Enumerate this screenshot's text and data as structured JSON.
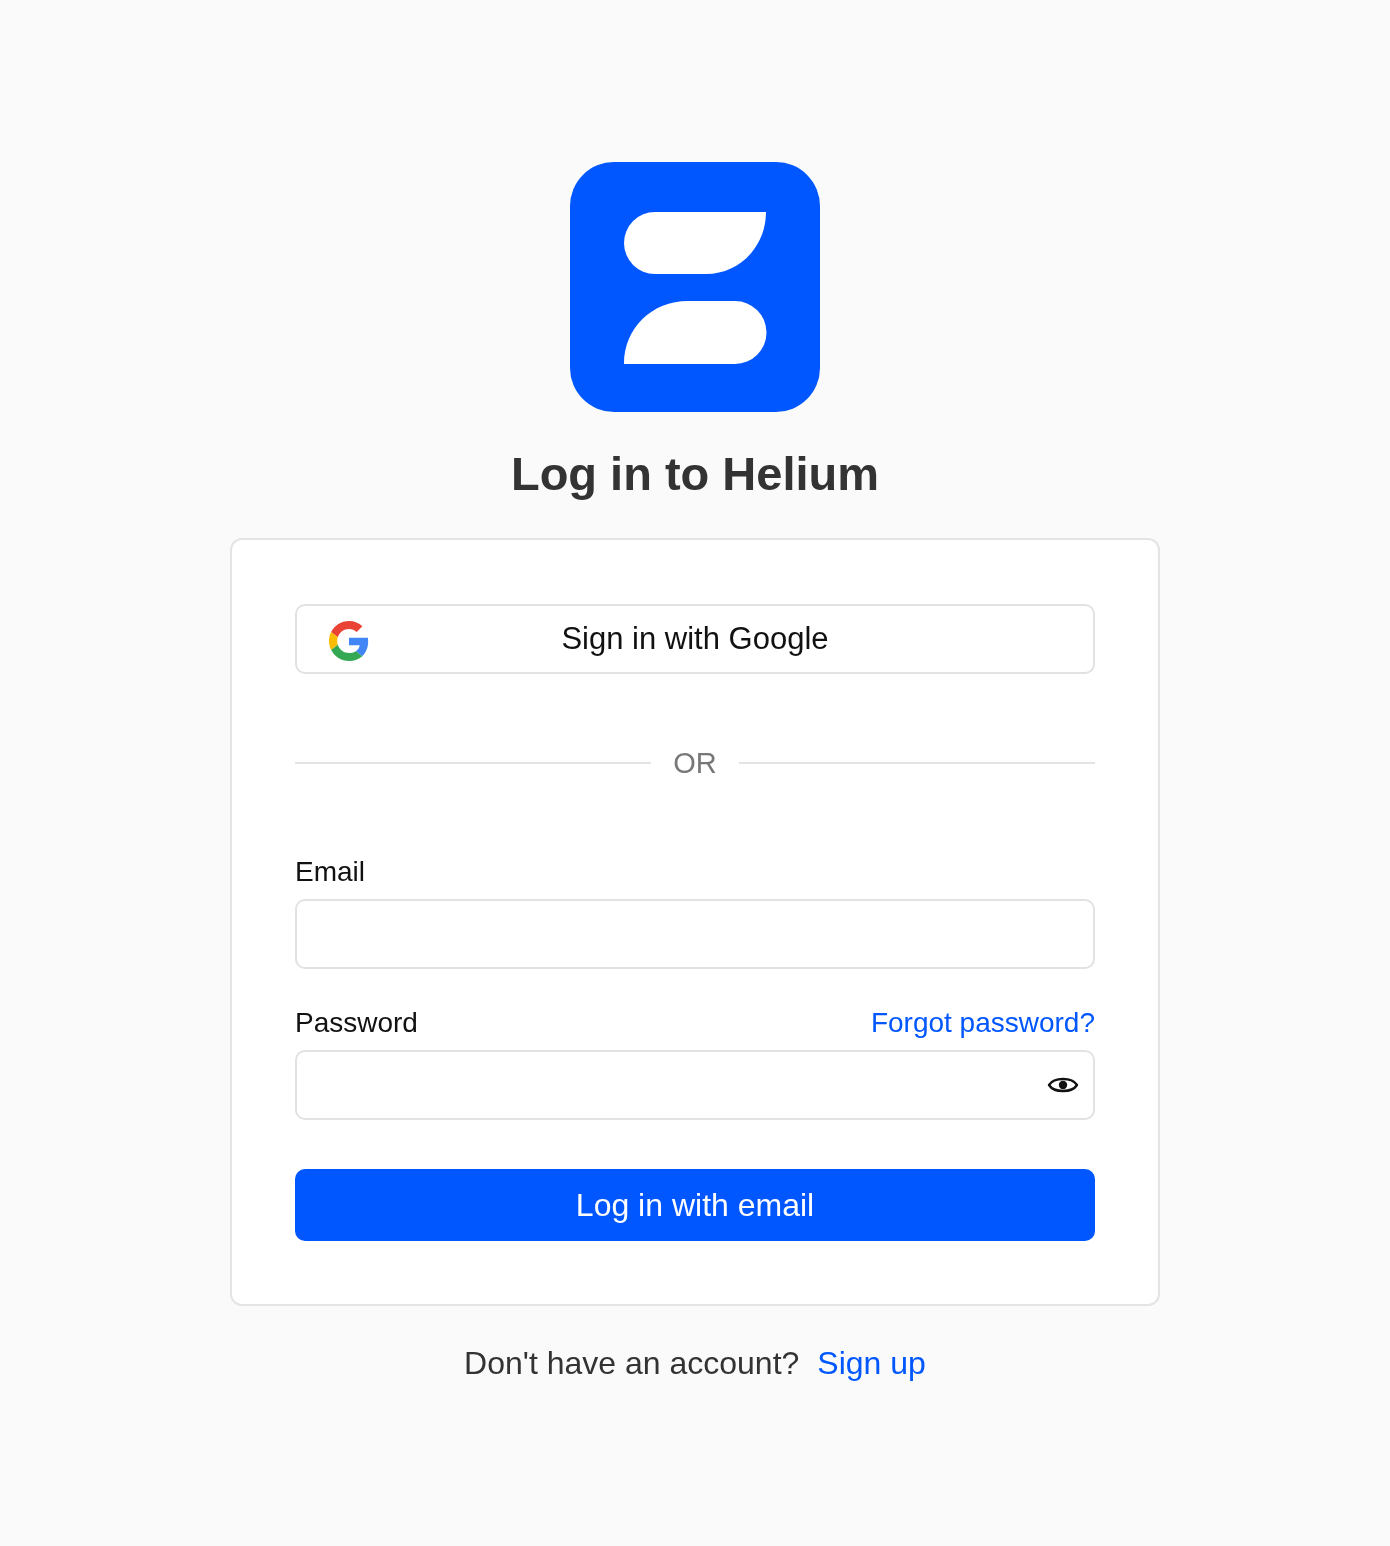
{
  "title": "Log in to Helium",
  "card": {
    "google_button": {
      "label": "Sign in with Google"
    },
    "divider": {
      "label": "OR"
    },
    "fields": [
      {
        "kind": "email",
        "label": "Email"
      },
      {
        "kind": "password",
        "label": "Password",
        "link": "Forgot password?"
      }
    ],
    "submit_button": {
      "label": "Log in with email"
    }
  },
  "footer": {
    "text": "Don't have an account?",
    "link": "Sign up"
  }
}
